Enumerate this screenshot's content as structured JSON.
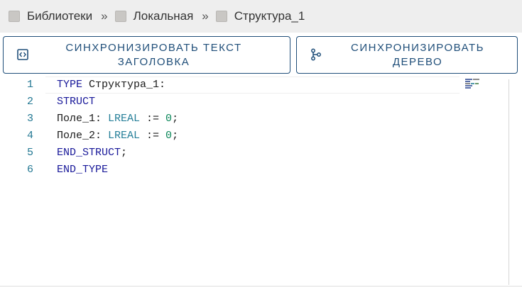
{
  "breadcrumb": {
    "items": [
      {
        "label": "Библиотеки",
        "icon": "folder-icon"
      },
      {
        "label": "Локальная",
        "icon": "folder-icon"
      },
      {
        "label": "Структура_1",
        "icon": "file-icon"
      }
    ],
    "separator": "»"
  },
  "toolbar": {
    "sync_text_button": {
      "line1": "СИНХРОНИЗИРОВАТЬ ТЕКСТ",
      "line2": "ЗАГОЛОВКА",
      "icon": "code-brackets-icon"
    },
    "sync_tree_button": {
      "line1": "СИНХРОНИЗИРОВАТЬ",
      "line2": "ДЕРЕВО",
      "icon": "tree-icon"
    }
  },
  "editor": {
    "lines": [
      {
        "num": "1",
        "tokens": [
          {
            "t": "TYPE",
            "c": "kw"
          },
          {
            "t": " Структура_1:",
            "c": ""
          }
        ]
      },
      {
        "num": "2",
        "tokens": [
          {
            "t": "STRUCT",
            "c": "kw"
          }
        ]
      },
      {
        "num": "3",
        "tokens": [
          {
            "t": "Поле_1: ",
            "c": ""
          },
          {
            "t": "LREAL",
            "c": "ty"
          },
          {
            "t": " := ",
            "c": ""
          },
          {
            "t": "0",
            "c": "num"
          },
          {
            "t": ";",
            "c": ""
          }
        ]
      },
      {
        "num": "4",
        "tokens": [
          {
            "t": "Поле_2: ",
            "c": ""
          },
          {
            "t": "LREAL",
            "c": "ty"
          },
          {
            "t": " := ",
            "c": ""
          },
          {
            "t": "0",
            "c": "num"
          },
          {
            "t": ";",
            "c": ""
          }
        ]
      },
      {
        "num": "5",
        "tokens": [
          {
            "t": "END_STRUCT",
            "c": "kw"
          },
          {
            "t": ";",
            "c": ""
          }
        ]
      },
      {
        "num": "6",
        "tokens": [
          {
            "t": "END_TYPE",
            "c": "kw"
          }
        ]
      }
    ]
  },
  "colors": {
    "accent": "#1f4e79",
    "keyword": "#1a1a9a",
    "type": "#267f99",
    "number": "#098658",
    "line_number": "#237893"
  }
}
